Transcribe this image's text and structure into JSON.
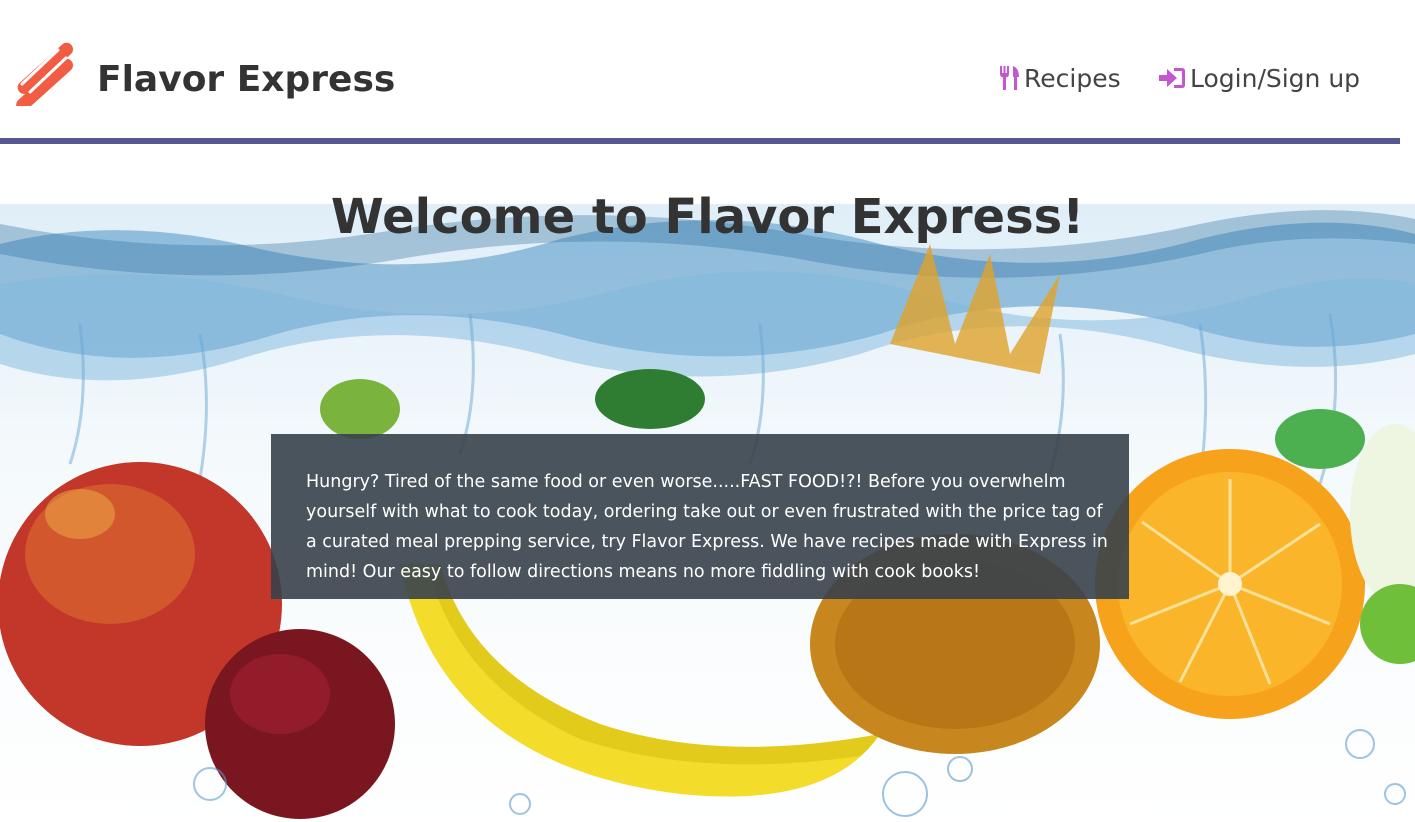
{
  "header": {
    "logo_icon": "hotdog-logo-icon",
    "brand": "Flavor Express",
    "nav": [
      {
        "label": "Recipes",
        "icon": "utensils-icon"
      },
      {
        "label": "Login/Sign up",
        "icon": "sign-in-icon"
      }
    ]
  },
  "colors": {
    "logo": "#f25c43",
    "nav_icon": "#c457d0",
    "rule": "#575792",
    "text": "#333333",
    "overlay": "#37414b"
  },
  "hero": {
    "title": "Welcome to Flavor Express!",
    "intro": "Hungry? Tired of the same food or even worse.....FAST FOOD!?! Before you overwhelm yourself with what to cook today, ordering take out or even frustrated with the price tag of a curated meal prepping service, try Flavor Express. We have recipes made with Express in mind! Our easy to follow directions means no more fiddling with cook books!"
  }
}
